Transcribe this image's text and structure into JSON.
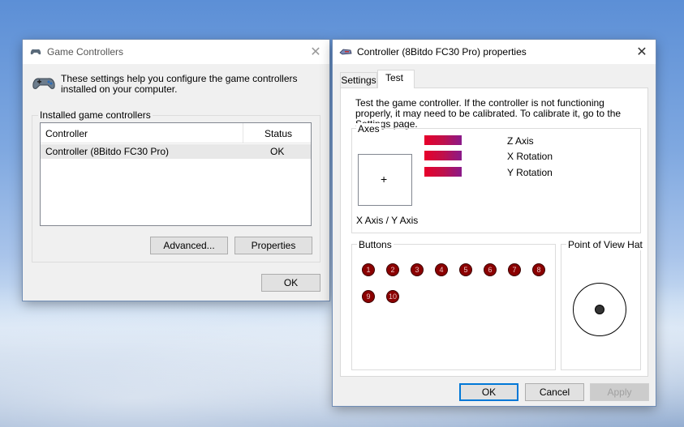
{
  "gc_window": {
    "title": "Game Controllers",
    "intro": "These settings help you configure the game controllers installed on your computer.",
    "installed_label": "Installed game controllers",
    "columns": [
      "Controller",
      "Status"
    ],
    "rows": [
      {
        "controller": "Controller (8Bitdo FC30 Pro)",
        "status": "OK"
      }
    ],
    "advanced_label": "Advanced...",
    "properties_label": "Properties",
    "ok_label": "OK"
  },
  "props_window": {
    "title": "Controller (8Bitdo FC30 Pro) properties",
    "tabs": [
      "Settings",
      "Test"
    ],
    "active_tab": "Test",
    "description": "Test the game controller.  If the controller is not functioning properly, it may need to be calibrated.  To calibrate it, go to the Settings page.",
    "axes_label": "Axes",
    "axis_items": [
      "Z Axis",
      "X Rotation",
      "Y Rotation"
    ],
    "xy_label": "X Axis / Y Axis",
    "buttons_label": "Buttons",
    "buttons": [
      "1",
      "2",
      "3",
      "4",
      "5",
      "6",
      "7",
      "8",
      "9",
      "10"
    ],
    "pov_label": "Point of View Hat",
    "ok_label": "OK",
    "cancel_label": "Cancel",
    "apply_label": "Apply"
  },
  "colors": {
    "accent": "#0078d7",
    "button_fill": "#8b0000",
    "window_bg": "#f0f0f0"
  },
  "icons": {
    "gamepad": "gamepad-icon",
    "close": "close-icon",
    "crosshair": "crosshair-icon"
  }
}
